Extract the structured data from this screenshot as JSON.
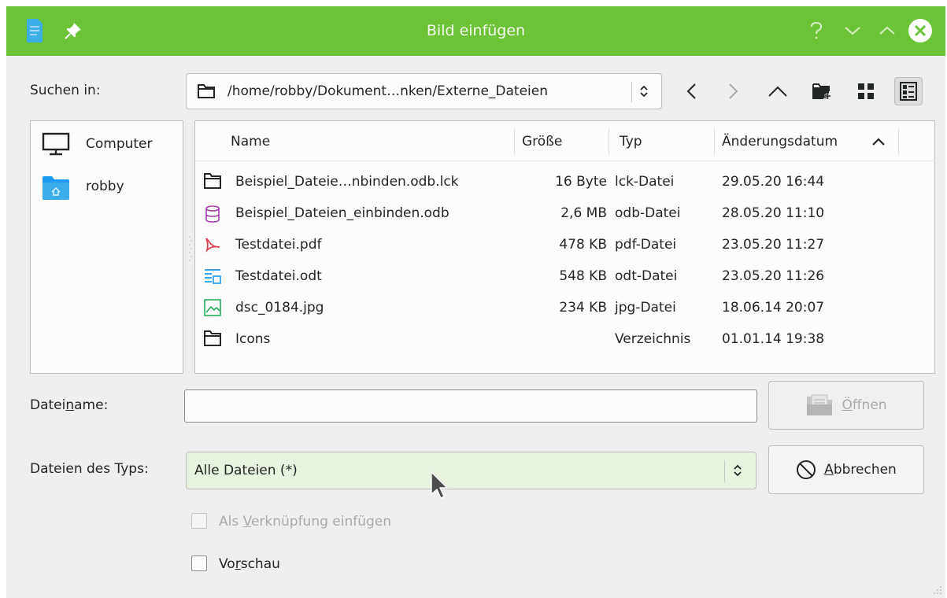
{
  "titlebar": {
    "title": "Bild einfügen",
    "accent": "#6bc437",
    "icons": [
      "document-icon",
      "pin-icon",
      "help-icon",
      "minimize-icon",
      "maximize-icon",
      "close-icon"
    ]
  },
  "look_in": {
    "label": "Suchen in:",
    "path": "/home/robby/Dokument…nken/Externe_Dateien"
  },
  "toolbar": {
    "buttons": [
      "back-icon",
      "forward-icon",
      "parent-folder-icon",
      "new-folder-icon",
      "icon-view-icon",
      "detail-view-icon"
    ]
  },
  "places": [
    {
      "label": "Computer",
      "icon": "computer-icon"
    },
    {
      "label": "robby",
      "icon": "home-folder-icon"
    }
  ],
  "files": {
    "columns": {
      "name": "Name",
      "size": "Größe",
      "type": "Typ",
      "date": "Änderungsdatum"
    },
    "rows": [
      {
        "name": "Beispiel_Dateie…nbinden.odb.lck",
        "size": "16 Byte",
        "type": "lck-Datei",
        "date": "29.05.20 16:44",
        "icon": "file-icon"
      },
      {
        "name": "Beispiel_Dateien_einbinden.odb",
        "size": "2,6 MB",
        "type": "odb-Datei",
        "date": "28.05.20 11:10",
        "icon": "database-icon"
      },
      {
        "name": "Testdatei.pdf",
        "size": "478 KB",
        "type": "pdf-Datei",
        "date": "23.05.20 11:27",
        "icon": "pdf-icon"
      },
      {
        "name": "Testdatei.odt",
        "size": "548 KB",
        "type": "odt-Datei",
        "date": "23.05.20 11:26",
        "icon": "text-document-icon"
      },
      {
        "name": "dsc_0184.jpg",
        "size": "234 KB",
        "type": "jpg-Datei",
        "date": "18.06.14 20:07",
        "icon": "image-icon"
      },
      {
        "name": "Icons",
        "size": "",
        "type": "Verzeichnis",
        "date": "01.01.14 19:38",
        "icon": "folder-icon"
      }
    ]
  },
  "filename": {
    "label_pre": "Datei",
    "label_u": "n",
    "label_post": "ame:",
    "value": ""
  },
  "filetype": {
    "label": "Dateien des Typs:",
    "value": "Alle Dateien (*)"
  },
  "buttons": {
    "open": {
      "label_u": "Ö",
      "label_rest": "ffnen"
    },
    "cancel": {
      "label_u": "A",
      "label_rest": "bbrechen"
    }
  },
  "options": {
    "link": {
      "pre": "Als ",
      "u": "V",
      "post": "erknüpfung einfügen",
      "checked": false,
      "enabled": false
    },
    "preview": {
      "pre": "Vo",
      "u": "r",
      "post": "schau",
      "checked": false
    }
  }
}
